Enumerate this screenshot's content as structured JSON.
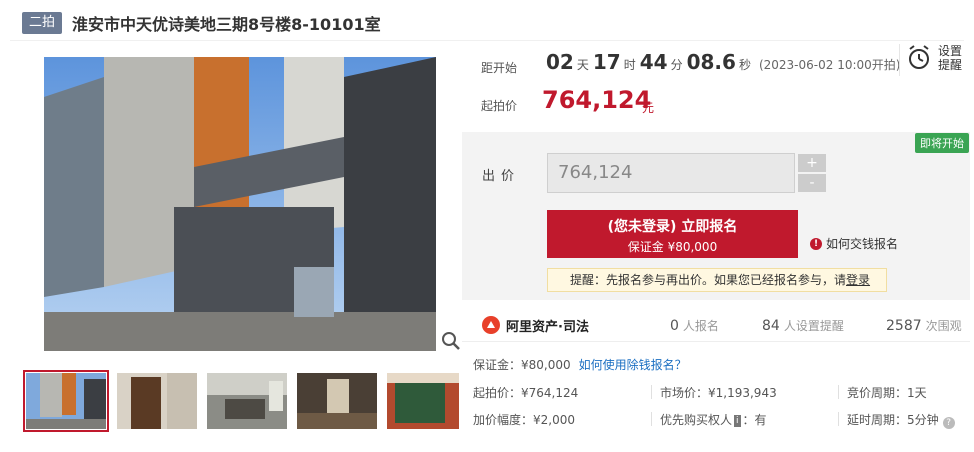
{
  "header": {
    "round_badge": "二拍",
    "title": "淮安市中天优诗美地三期8号楼8-10101室"
  },
  "countdown": {
    "label": "距开始",
    "days": "02",
    "days_unit": "天",
    "hours": "17",
    "hours_unit": "时",
    "minutes": "44",
    "minutes_unit": "分",
    "seconds": "08.6",
    "seconds_unit": "秒",
    "start_time": "(2023-06-02 10:00开拍)"
  },
  "starting_price": {
    "label": "起拍价",
    "value": "764,124",
    "unit": "元"
  },
  "reminder": {
    "label": "设置提醒",
    "icon": "alarm-clock-icon"
  },
  "bid_panel": {
    "status_badge": "即将开始",
    "bid_label": "出价",
    "bid_value": "764,124",
    "increase_symbol": "+",
    "decrease_symbol": "-",
    "signup_main": "(您未登录) 立即报名",
    "signup_deposit": "保证金 ¥80,000",
    "pay_help_icon": "!",
    "pay_help": "如何交钱报名",
    "tip_text": "提醒：先报名参与再出价。如果您已经报名参与，请",
    "tip_link": "登录"
  },
  "stats": {
    "platform": "阿里资产·司法",
    "signups": "0",
    "signups_label": "人报名",
    "reminders": "84",
    "reminders_label": "人设置提醒",
    "views": "2587",
    "views_label": "次围观"
  },
  "info": {
    "deposit": "保证金：¥80,000",
    "deposit_help_link": "如何使用除钱报名？",
    "start_price": "起拍价：¥764,124",
    "market_price": "市场价：¥1,193,943",
    "bid_cycle": "竞价周期：1天",
    "increment": "加价幅度：¥2,000",
    "priority_buyer_label": "优先购买权人",
    "priority_buyer_badge": "i",
    "priority_buyer_value": "：有",
    "delay_cycle": "延时周期：5分钟",
    "delay_help_icon": "?"
  },
  "colors": {
    "accent": "#c0192d",
    "badge_gray": "#6b7a93",
    "status_green": "#3aa453",
    "link_blue": "#1b6fc2"
  }
}
